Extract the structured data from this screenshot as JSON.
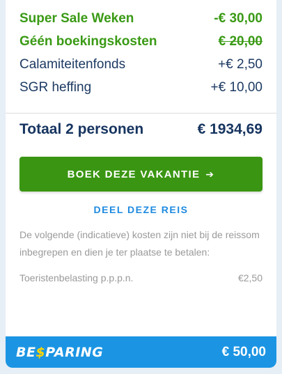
{
  "lines": [
    {
      "label": "Super Sale Weken",
      "value": "-€ 30,00",
      "kind": "discount",
      "strike": false
    },
    {
      "label": "Géén boekingskosten",
      "value": "€ 20,00",
      "kind": "discount",
      "strike": true
    },
    {
      "label": "Calamiteitenfonds",
      "value": "+€ 2,50",
      "kind": "normal",
      "strike": false
    },
    {
      "label": "SGR heffing",
      "value": "+€ 10,00",
      "kind": "normal",
      "strike": false
    }
  ],
  "total": {
    "label": "Totaal 2 personen",
    "value": "€ 1934,69"
  },
  "cta": {
    "label": "BOEK DEZE VAKANTIE",
    "arrow": "➔"
  },
  "share": {
    "label": "DEEL DEZE REIS"
  },
  "note": {
    "text": "De volgende (indicatieve) kosten zijn niet bij de reissom inbegrepen en dien je ter plaatse te betalen:"
  },
  "tax": {
    "label": "Toeristenbelasting p.p.p.n.",
    "value": "€2,50"
  },
  "savings": {
    "logo_before": "BE",
    "logo_dollar": "$",
    "logo_after": "PARING",
    "amount": "€ 50,00"
  },
  "colors": {
    "green": "#3a9612",
    "navy": "#173560",
    "blue": "#1b95e3",
    "link": "#1d8ae0",
    "yellow": "#ffd400"
  }
}
